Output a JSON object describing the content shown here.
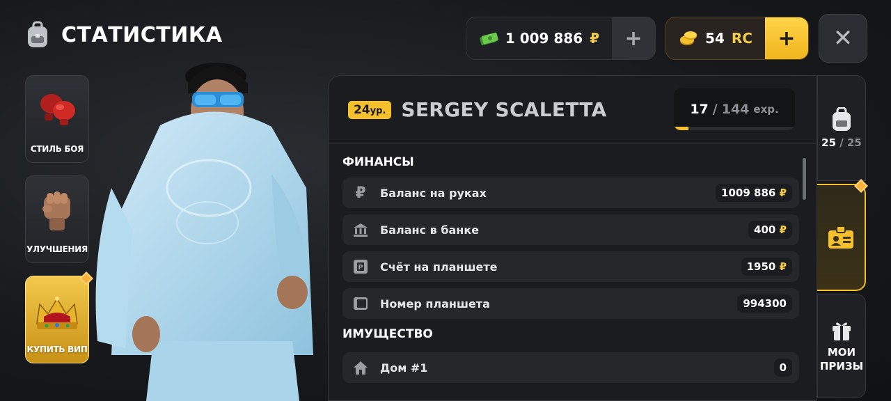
{
  "header": {
    "title": "СТАТИСТИКА"
  },
  "left_menu": [
    {
      "label": "СТИЛЬ БОЯ"
    },
    {
      "label": "УЛУЧШЕНИЯ"
    },
    {
      "label": "КУПИТЬ ВИП"
    }
  ],
  "currency": {
    "cash": {
      "amount": "1 009 886",
      "symbol": "₽"
    },
    "rc": {
      "amount": "54",
      "unit": "RC"
    }
  },
  "player": {
    "level": "24",
    "level_unit": "ур.",
    "name": "SERGEY SCALETTA",
    "exp_current": "17",
    "exp_sep": "/",
    "exp_total": "144",
    "exp_unit": "exp.",
    "exp_progress": 0.118
  },
  "finance": {
    "title": "ФИНАНСЫ",
    "rows": [
      {
        "label": "Баланс на руках",
        "value": "1009 886",
        "suffix": "₽"
      },
      {
        "label": "Баланс в банке",
        "value": "400",
        "suffix": "₽"
      },
      {
        "label": "Счёт на планшете",
        "value": "1950",
        "suffix": "₽"
      },
      {
        "label": "Номер планшета",
        "value": "994300",
        "suffix": ""
      }
    ]
  },
  "property": {
    "title": "ИМУЩЕСТВО",
    "rows": [
      {
        "label": "Дом #1",
        "value": "0"
      }
    ]
  },
  "right_tabs": {
    "inventory": {
      "current": "25",
      "sep": "/",
      "max": "25"
    },
    "prizes": {
      "line1": "МОИ",
      "line2": "ПРИЗЫ"
    }
  },
  "colors": {
    "accent": "#f5c02b",
    "background": "#17191c",
    "panel": "#1a1c1f"
  }
}
